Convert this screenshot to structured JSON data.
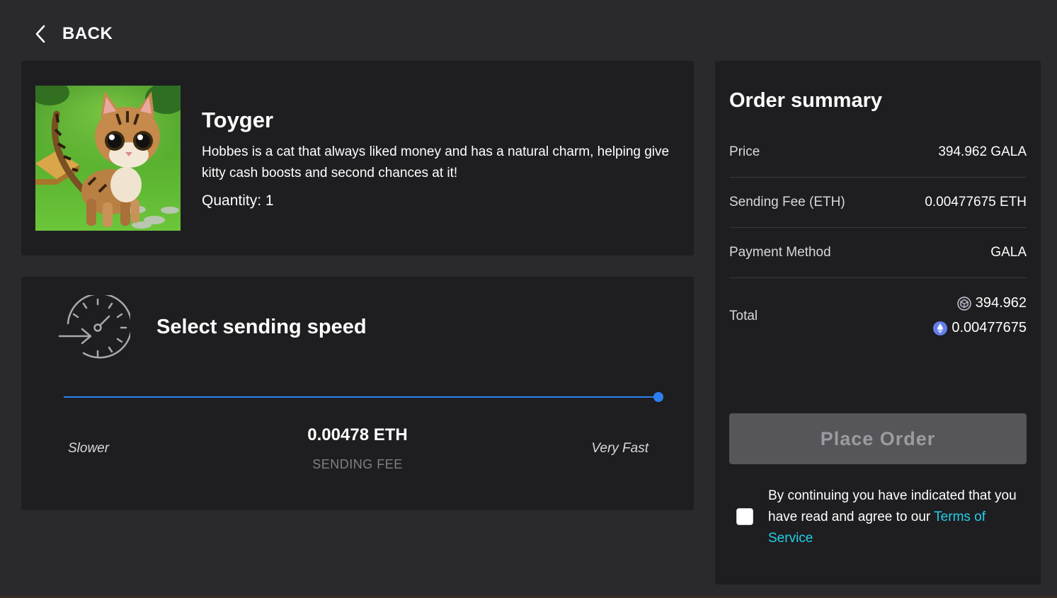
{
  "back": {
    "label": "BACK",
    "icon": "chevron-left-icon"
  },
  "product": {
    "name": "Toyger",
    "description": "Hobbes is a cat that always liked money and has a natural charm, helping give kitty cash boosts and second chances at it!",
    "quantity_label": "Quantity:",
    "quantity_value": "1"
  },
  "speed": {
    "title": "Select sending speed",
    "icon": "speedometer-icon",
    "slider_value": 1.0,
    "slow_label": "Slower",
    "fast_label": "Very Fast",
    "fee_value": "0.00478 ETH",
    "fee_label": "SENDING FEE",
    "accent_color": "#2d7ff0"
  },
  "summary": {
    "title": "Order summary",
    "rows": [
      {
        "label": "Price",
        "value": "394.962 GALA"
      },
      {
        "label": "Sending Fee (ETH)",
        "value": "0.00477675 ETH"
      },
      {
        "label": "Payment Method",
        "value": "GALA"
      }
    ],
    "total": {
      "label": "Total",
      "gala_icon": "gala-coin-icon",
      "gala_value": "394.962",
      "eth_icon": "eth-coin-icon",
      "eth_value": "0.00477675"
    },
    "place_order_label": "Place Order",
    "agree_text": "By continuing you have indicated that you have read and agree to our",
    "terms_label": "Terms of Service",
    "link_color": "#21d0e6"
  }
}
